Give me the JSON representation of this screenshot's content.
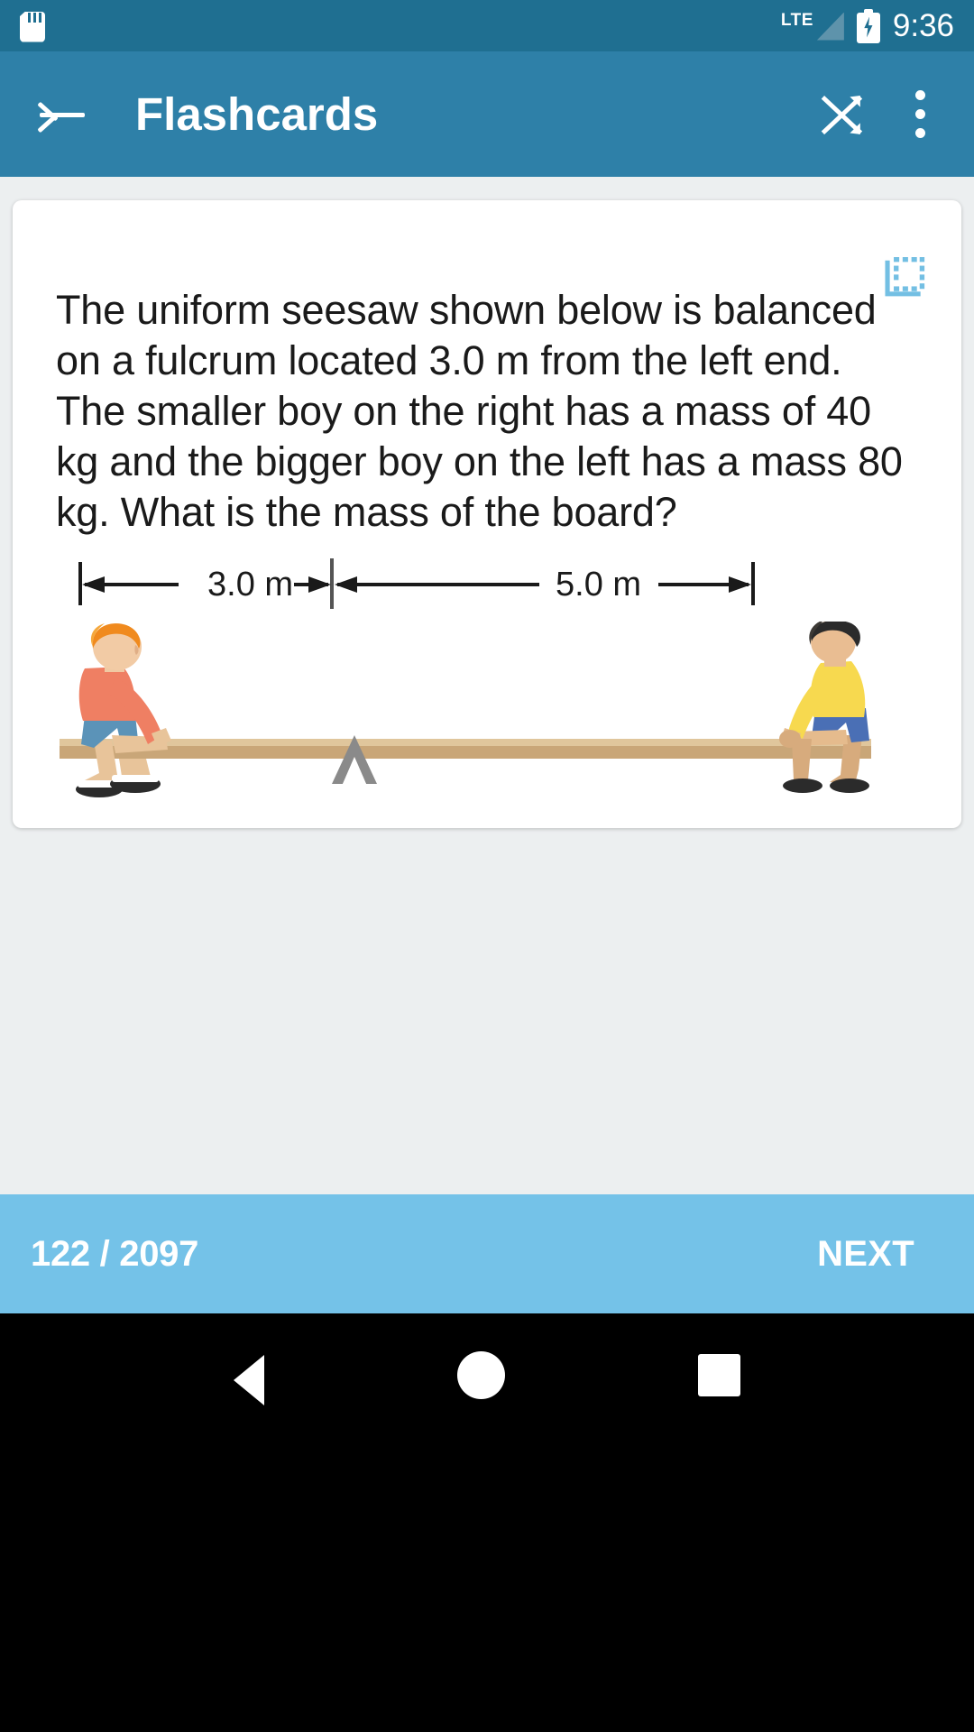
{
  "status_bar": {
    "sd_card_icon": "sd-card-icon",
    "network_label": "LTE",
    "signal_icon": "signal-bars-icon",
    "battery_icon": "battery-charging-icon",
    "time": "9:36"
  },
  "app_bar": {
    "back_icon": "arrow-back-icon",
    "title": "Flashcards",
    "shuffle_icon": "shuffle-icon",
    "overflow_icon": "more-vert-icon"
  },
  "card": {
    "crop_icon": "crop-select-icon",
    "question": "The uniform seesaw shown below is balanced on a fulcrum located 3.0 m from the left end. The smaller boy on the right has a mass of 40 kg and the bigger boy on the left has a mass 80 kg. What is the mass of the board?",
    "figure": {
      "left_dimension_label": "3.0 m",
      "right_dimension_label": "5.0 m",
      "left_boy": {
        "hair_color": "#f08a1e",
        "shirt_color": "#ef7f63",
        "shorts_color": "#5b93b8"
      },
      "right_boy": {
        "hair_color": "#2b2b2b",
        "shirt_color": "#f7d94f",
        "shorts_color": "#4a6fb5"
      },
      "plank_color": "#c9a678",
      "fulcrum_color": "#8a8a8a"
    }
  },
  "bottom_bar": {
    "counter": "122 / 2097",
    "next_label": "NEXT"
  },
  "nav_bar": {
    "back_icon": "nav-back-icon",
    "home_icon": "nav-home-icon",
    "recents_icon": "nav-recents-icon"
  },
  "colors": {
    "status_bar": "#1f6f91",
    "app_bar": "#2e80a8",
    "bottom_bar": "#74c2e8",
    "page_background": "#eceff0",
    "card_background": "#ffffff",
    "accent_icon": "#73bfe3"
  }
}
